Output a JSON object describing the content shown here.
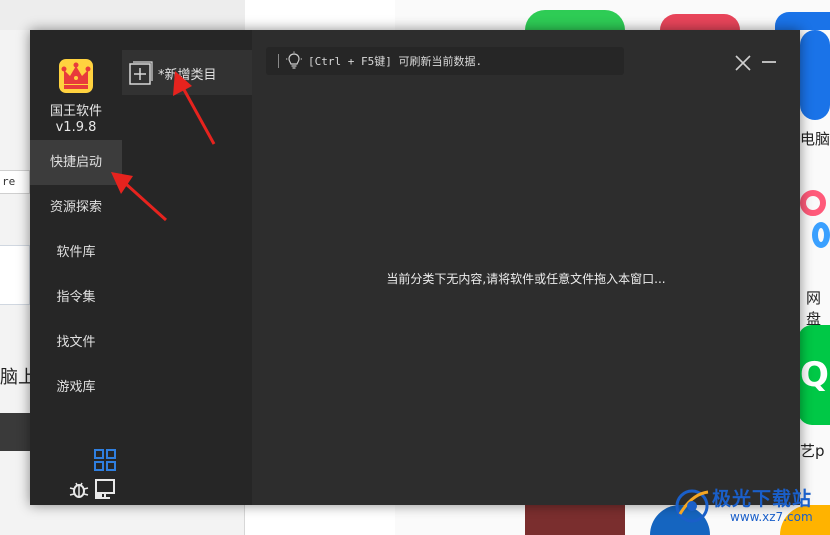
{
  "background": {
    "left_field_text": "re",
    "left_text": "脑上",
    "right_labels": [
      "电脑",
      "网盘",
      "艺p"
    ],
    "iqiyi_text": "QI"
  },
  "watermark": {
    "title": "极光下载站",
    "url": "www.xz7.com"
  },
  "app": {
    "name": "国王软件",
    "version": "v1.9.8",
    "nav": [
      {
        "label": "快捷启动",
        "active": true
      },
      {
        "label": "资源探索",
        "active": false
      },
      {
        "label": "软件库",
        "active": false
      },
      {
        "label": "指令集",
        "active": false
      },
      {
        "label": "找文件",
        "active": false
      },
      {
        "label": "游戏库",
        "active": false
      }
    ],
    "category": {
      "add_label": "*新增类目"
    },
    "hint": "[Ctrl + F5键] 可刷新当前数据.",
    "empty_message": "当前分类下无内容,请将软件或任意文件拖入本窗口...",
    "accent_color": "#2f7fe0",
    "annotation_color": "#e6231e"
  }
}
